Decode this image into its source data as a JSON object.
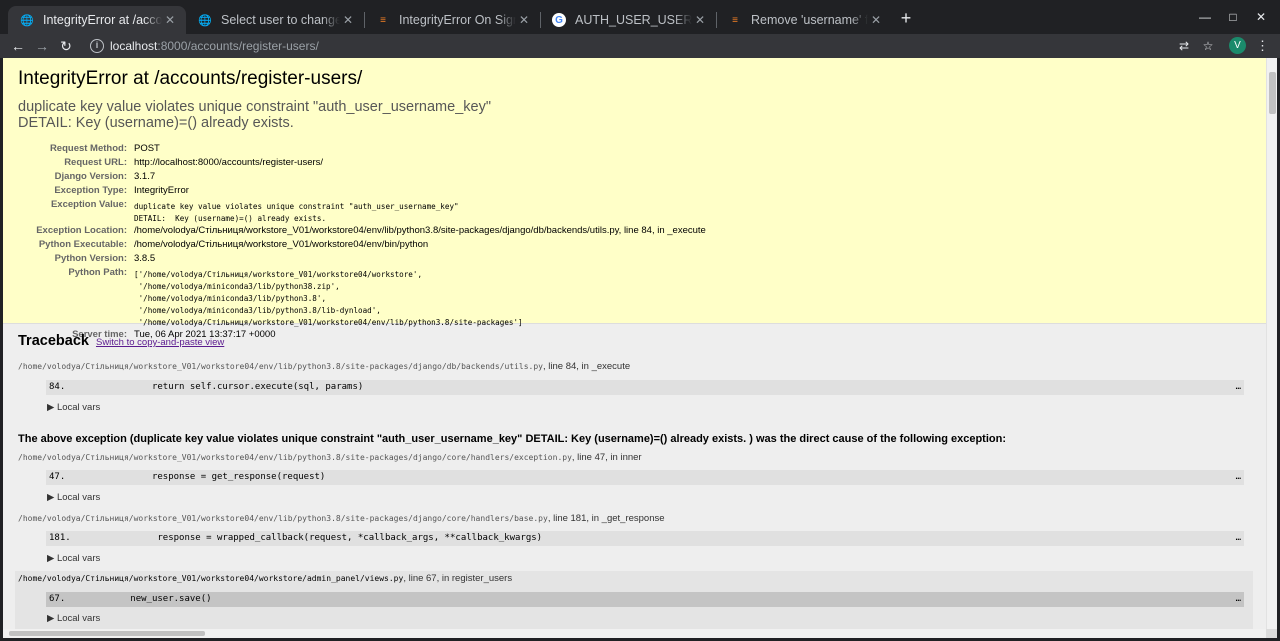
{
  "browser": {
    "tabs": [
      {
        "title": "IntegrityError at /accounts/",
        "favicon": "globe-icon"
      },
      {
        "title": "Select user to change | Django",
        "favicon": "globe-icon"
      },
      {
        "title": "IntegrityError On SignUp",
        "favicon": "stackoverflow-icon"
      },
      {
        "title": "AUTH_USER_USERNAME_",
        "favicon": "google-icon"
      },
      {
        "title": "Remove 'username' field",
        "favicon": "stackoverflow-icon"
      }
    ],
    "url_host": "localhost",
    "url_path": ":8000/accounts/register-users/",
    "avatar_letter": "V"
  },
  "error": {
    "title": "IntegrityError at /accounts/register-users/",
    "message_line1": "duplicate key value violates unique constraint \"auth_user_username_key\"",
    "message_line2": "DETAIL:  Key (username)=() already exists."
  },
  "meta": [
    {
      "label": "Request Method:",
      "value": "POST",
      "mono": false
    },
    {
      "label": "Request URL:",
      "value": "http://localhost:8000/accounts/register-users/",
      "mono": false
    },
    {
      "label": "Django Version:",
      "value": "3.1.7",
      "mono": false
    },
    {
      "label": "Exception Type:",
      "value": "IntegrityError",
      "mono": false
    },
    {
      "label": "Exception Value:",
      "value": "duplicate key value violates unique constraint \"auth_user_username_key\"\nDETAIL:  Key (username)=() already exists.",
      "mono": true
    },
    {
      "label": "Exception Location:",
      "value": "/home/volodya/Стільниця/workstore_V01/workstore04/env/lib/python3.8/site-packages/django/db/backends/utils.py, line 84, in _execute",
      "mono": false
    },
    {
      "label": "Python Executable:",
      "value": "/home/volodya/Стільниця/workstore_V01/workstore04/env/bin/python",
      "mono": false
    },
    {
      "label": "Python Version:",
      "value": "3.8.5",
      "mono": false
    },
    {
      "label": "Python Path:",
      "value": "['/home/volodya/Стільниця/workstore_V01/workstore04/workstore',\n '/home/volodya/miniconda3/lib/python38.zip',\n '/home/volodya/miniconda3/lib/python3.8',\n '/home/volodya/miniconda3/lib/python3.8/lib-dynload',\n '/home/volodya/Стільниця/workstore_V01/workstore04/env/lib/python3.8/site-packages']",
      "mono": true
    },
    {
      "label": "Server time:",
      "value": "Tue, 06 Apr 2021 13:37:17 +0000",
      "mono": false
    }
  ],
  "traceback": {
    "title": "Traceback",
    "switch_link": "Switch to copy-and-paste view",
    "local_vars_label": "▶ Local vars",
    "cause": "The above exception (duplicate key value violates unique constraint \"auth_user_username_key\" DETAIL: Key (username)=() already exists. ) was the direct cause of the following exception:",
    "frames": [
      {
        "path": "/home/volodya/Стільниця/workstore_V01/workstore04/env/lib/python3.8/site-packages/django/db/backends/utils.py",
        "suffix": ", line 84, in _execute",
        "line": "84.",
        "code": "                return self.cursor.execute(sql, params)"
      },
      {
        "path": "/home/volodya/Стільниця/workstore_V01/workstore04/env/lib/python3.8/site-packages/django/core/handlers/exception.py",
        "suffix": ", line 47, in inner",
        "line": "47.",
        "code": "                response = get_response(request)"
      },
      {
        "path": "/home/volodya/Стільниця/workstore_V01/workstore04/env/lib/python3.8/site-packages/django/core/handlers/base.py",
        "suffix": ", line 181, in _get_response",
        "line": "181.",
        "code": "                response = wrapped_callback(request, *callback_args, **callback_kwargs)"
      },
      {
        "path": "/home/volodya/Стільниця/workstore_V01/workstore04/workstore/admin_panel/views.py",
        "suffix": ", line 67, in register_users",
        "line": "67.",
        "code": "            new_user.save()"
      }
    ],
    "ellipsis": "…"
  }
}
